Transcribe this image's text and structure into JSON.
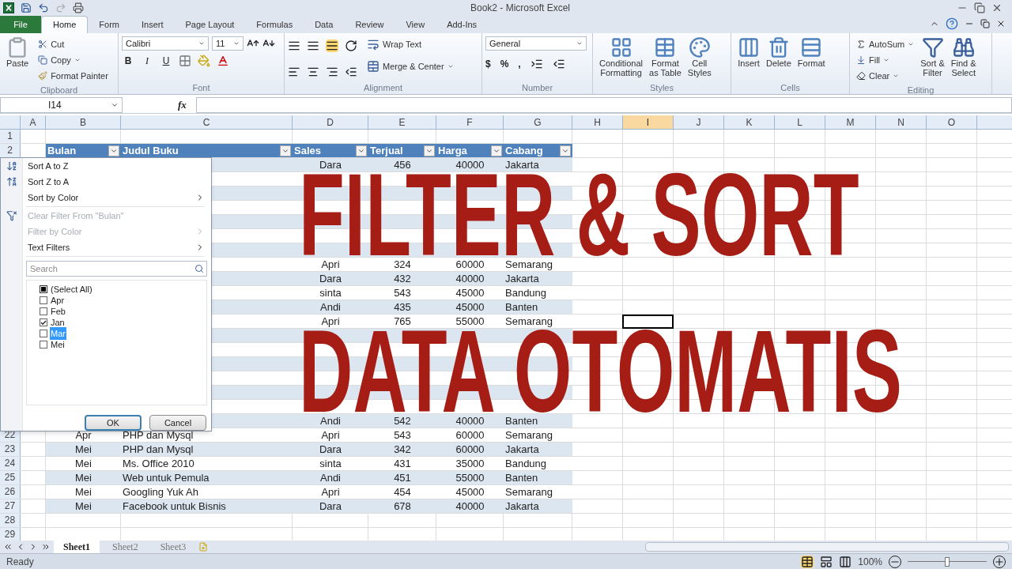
{
  "window": {
    "title": "Book2 - Microsoft Excel"
  },
  "tabs": [
    {
      "label": "File",
      "kind": "file",
      "selected": false
    },
    {
      "label": "Home",
      "kind": "tab",
      "selected": true
    },
    {
      "label": "Form",
      "kind": "tab",
      "selected": false
    },
    {
      "label": "Insert",
      "kind": "tab",
      "selected": false
    },
    {
      "label": "Page Layout",
      "kind": "tab",
      "selected": false
    },
    {
      "label": "Formulas",
      "kind": "tab",
      "selected": false
    },
    {
      "label": "Data",
      "kind": "tab",
      "selected": false
    },
    {
      "label": "Review",
      "kind": "tab",
      "selected": false
    },
    {
      "label": "View",
      "kind": "tab",
      "selected": false
    },
    {
      "label": "Add-Ins",
      "kind": "tab",
      "selected": false
    }
  ],
  "ribbon": {
    "clipboard": {
      "label": "Clipboard",
      "paste": "Paste",
      "cut": "Cut",
      "copy": "Copy",
      "format_painter": "Format Painter"
    },
    "font": {
      "label": "Font",
      "name": "Calibri",
      "size": "11",
      "bold": "B",
      "italic": "I",
      "underline": "U"
    },
    "alignment": {
      "label": "Alignment",
      "wrap": "Wrap Text",
      "merge": "Merge & Center"
    },
    "number": {
      "label": "Number",
      "format": "General",
      "currency": "$",
      "percent": "%",
      "comma": ","
    },
    "styles": {
      "label": "Styles",
      "buttons": [
        {
          "lines": [
            "Conditional",
            "Formatting"
          ],
          "kind": "conditional"
        },
        {
          "lines": [
            "Format",
            "as Table"
          ],
          "kind": "table"
        },
        {
          "lines": [
            "Cell",
            "Styles"
          ],
          "kind": "cell"
        }
      ]
    },
    "cells": {
      "label": "Cells",
      "buttons": [
        {
          "label": "Insert",
          "kind": "insert"
        },
        {
          "label": "Delete",
          "kind": "delete"
        },
        {
          "label": "Format",
          "kind": "format"
        }
      ]
    },
    "editing": {
      "label": "Editing",
      "autosum": "AutoSum",
      "fill": "Fill",
      "clear": "Clear",
      "buttons": [
        {
          "lines": [
            "Sort &",
            "Filter"
          ],
          "kind": "sort"
        },
        {
          "lines": [
            "Find &",
            "Select"
          ],
          "kind": "find"
        }
      ]
    }
  },
  "formula_bar": {
    "name_box": "I14",
    "function_label": "fx"
  },
  "columns": [
    {
      "label": "A",
      "selected": false
    },
    {
      "label": "B",
      "selected": false
    },
    {
      "label": "C",
      "selected": false
    },
    {
      "label": "D",
      "selected": false
    },
    {
      "label": "E",
      "selected": false
    },
    {
      "label": "F",
      "selected": false
    },
    {
      "label": "G",
      "selected": false
    },
    {
      "label": "H",
      "selected": false
    },
    {
      "label": "I",
      "selected": true
    },
    {
      "label": "J",
      "selected": false
    },
    {
      "label": "K",
      "selected": false
    },
    {
      "label": "L",
      "selected": false
    },
    {
      "label": "M",
      "selected": false
    },
    {
      "label": "N",
      "selected": false
    },
    {
      "label": "O",
      "selected": false
    }
  ],
  "row_numbers": [
    {
      "label": "1",
      "selected": false
    },
    {
      "label": "2",
      "selected": false
    },
    {
      "label": "22",
      "selected": false
    },
    {
      "label": "23",
      "selected": false
    },
    {
      "label": "24",
      "selected": false
    },
    {
      "label": "25",
      "selected": false
    },
    {
      "label": "26",
      "selected": false
    },
    {
      "label": "27",
      "selected": false
    },
    {
      "label": "28",
      "selected": false
    },
    {
      "label": "29",
      "selected": false
    }
  ],
  "active_cell": {
    "shown": true
  },
  "table": {
    "headers": [
      "Bulan",
      "Judul Buku",
      "Sales",
      "Terjual",
      "Harga",
      "Cabang"
    ],
    "rows": [
      {
        "D": "Dara",
        "E": "456",
        "F": "40000",
        "G": "Jakarta"
      },
      {},
      {},
      {},
      {},
      {},
      {},
      {
        "D": "Apri",
        "E": "324",
        "F": "60000",
        "G": "Semarang"
      },
      {
        "D": "Dara",
        "E": "432",
        "F": "40000",
        "G": "Jakarta"
      },
      {
        "D": "sinta",
        "E": "543",
        "F": "45000",
        "G": "Bandung"
      },
      {
        "D": "Andi",
        "E": "435",
        "F": "45000",
        "G": "Banten"
      },
      {
        "D": "Apri",
        "E": "765",
        "F": "55000",
        "G": "Semarang"
      },
      {},
      {},
      {},
      {},
      {},
      {},
      {
        "D": "Andi",
        "E": "542",
        "F": "40000",
        "G": "Banten"
      },
      {
        "B": "Apr",
        "C": "PHP dan Mysql",
        "D": "Apri",
        "E": "543",
        "F": "60000",
        "G": "Semarang"
      },
      {
        "B": "Mei",
        "C": "PHP dan Mysql",
        "D": "Dara",
        "E": "342",
        "F": "60000",
        "G": "Jakarta"
      },
      {
        "B": "Mei",
        "C": "Ms. Office 2010",
        "D": "sinta",
        "E": "431",
        "F": "35000",
        "G": "Bandung"
      },
      {
        "B": "Mei",
        "C": "Web untuk Pemula",
        "D": "Andi",
        "E": "451",
        "F": "55000",
        "G": "Banten"
      },
      {
        "B": "Mei",
        "C": "Googling Yuk Ah",
        "D": "Apri",
        "E": "454",
        "F": "45000",
        "G": "Semarang"
      },
      {
        "B": "Mei",
        "C": "Facebook untuk Bisnis",
        "D": "Dara",
        "E": "678",
        "F": "40000",
        "G": "Jakarta"
      }
    ]
  },
  "filter_menu": {
    "items": [
      {
        "label": "Sort A to Z",
        "kind": "sort_asc",
        "disabled": false,
        "submenu": false
      },
      {
        "label": "Sort Z to A",
        "kind": "sort_desc",
        "disabled": false,
        "submenu": false
      },
      {
        "label": "Sort by Color",
        "kind": "plain",
        "disabled": false,
        "submenu": true
      },
      {
        "label": "Clear Filter From \"Bulan\"",
        "kind": "clear",
        "disabled": true,
        "submenu": false
      },
      {
        "label": "Filter by Color",
        "kind": "plain",
        "disabled": true,
        "submenu": true
      },
      {
        "label": "Text Filters",
        "kind": "plain",
        "disabled": false,
        "submenu": true
      }
    ],
    "search": {
      "placeholder": "Search"
    },
    "values": [
      {
        "label": "(Select All)",
        "kind": "select_all",
        "checked": true,
        "selected": false
      },
      {
        "label": "Apr",
        "kind": "value",
        "checked": false,
        "selected": false
      },
      {
        "label": "Feb",
        "kind": "value",
        "checked": false,
        "selected": false
      },
      {
        "label": "Jan",
        "kind": "value",
        "checked": true,
        "selected": false
      },
      {
        "label": "Mar",
        "kind": "value",
        "checked": false,
        "selected": true
      },
      {
        "label": "Mei",
        "kind": "value",
        "checked": false,
        "selected": false
      }
    ],
    "buttons": [
      {
        "label": "OK",
        "primary": true
      },
      {
        "label": "Cancel",
        "primary": false
      }
    ]
  },
  "overlay_title": {
    "lines": [
      "FILTER & SORT",
      "DATA OTOMATIS"
    ]
  },
  "sheets": [
    {
      "label": "Sheet1",
      "selected": true
    },
    {
      "label": "Sheet2",
      "selected": false
    },
    {
      "label": "Sheet3",
      "selected": false
    }
  ],
  "status_bar": {
    "status": "Ready",
    "zoom": "100%",
    "zoom_slider": {
      "level": 0.5
    }
  }
}
